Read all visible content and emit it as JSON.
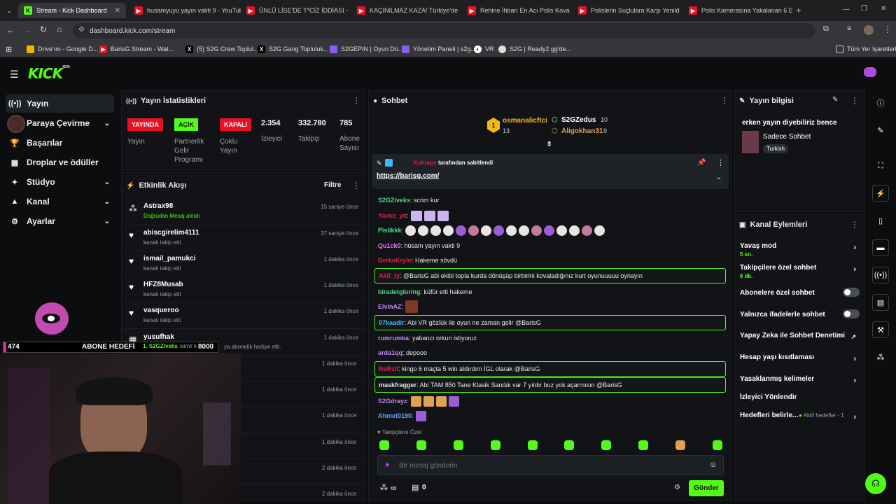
{
  "browser": {
    "tabs": [
      {
        "label": "Stream - Kick Dashboard",
        "active": true
      },
      {
        "label": "husamyuyu yayın vakti 9 - YouTube"
      },
      {
        "label": "ÜNLÜ LİSE'DE T*CİZ İDDİASI -"
      },
      {
        "label": "KAÇINILMAZ KAZA! Türkiye'de"
      },
      {
        "label": "Rehine İhbarı En Acı Polis Kova"
      },
      {
        "label": "Polislerin Suçlulara Karşı Yenild"
      },
      {
        "label": "Polis Kamerasına Yakalanan 6 E"
      }
    ],
    "url": "dashboard.kick.com/stream",
    "bookmarks": [
      "Drive'ım - Google D...",
      "BarisG Stream - Wat...",
      "(5) S2G Crew Toplul...",
      "S2G Gang Topluluk...",
      "S2GEPIN | Oyun Dü...",
      "Yönetim Paneli | s2g...",
      "VR",
      "S2G | Ready2.gg'de..."
    ],
    "all_bookmarks": "Tüm Yer İşaretleri"
  },
  "nav": {
    "items": [
      {
        "label": "Yayın",
        "icon": "broadcast-icon"
      },
      {
        "label": "Paraya Çevirme",
        "icon": "avatar"
      },
      {
        "label": "Başarılar",
        "icon": "trophy-icon"
      },
      {
        "label": "Droplar ve ödüller",
        "icon": "gift-icon"
      },
      {
        "label": "Stüdyo",
        "icon": "studio-icon"
      },
      {
        "label": "Kanal",
        "icon": "channel-icon"
      },
      {
        "label": "Ayarlar",
        "icon": "gear-icon"
      }
    ]
  },
  "stats": {
    "title": "Yayın İstatistikleri",
    "badges": [
      {
        "text": "YAYINDA",
        "label": "Yayın",
        "color": "#e81123"
      },
      {
        "text": "AÇIK",
        "label": "Partnerlik Gelir Programı",
        "color": "#53fc18"
      },
      {
        "text": "KAPALI",
        "label": "Çoklu Yayın",
        "color": "#e81123"
      }
    ],
    "numbers": [
      {
        "value": "2.354",
        "label": "İzleyici"
      },
      {
        "value": "332.780",
        "label": "Takipçi"
      },
      {
        "value": "785",
        "label": "Abone Sayısı"
      }
    ]
  },
  "activity": {
    "title": "Etkinlik Akışı",
    "filter": "Filtre",
    "events": [
      {
        "name": "Astrax98",
        "sub": "Doğrudan Mesaj alındı",
        "time": "15 saniye önce",
        "icon": "people-icon"
      },
      {
        "name": "abiscgirelim4111",
        "sub": "kanalı takip etti",
        "time": "37 saniye önce",
        "icon": "heart-icon"
      },
      {
        "name": "ismail_pamukci",
        "sub": "kanalı takip etti",
        "time": "1 dakika önce",
        "icon": "heart-icon"
      },
      {
        "name": "HFZ8Musab",
        "sub": "kanalı takip etti",
        "time": "1 dakika önce",
        "icon": "heart-icon"
      },
      {
        "name": "vasqueroo",
        "sub": "kanalı takip etti",
        "time": "1 dakika önce",
        "icon": "heart-icon"
      },
      {
        "name": "yusufhak",
        "sub": "ya abonelik hediye etti.",
        "time": "1 dakika önce",
        "icon": "gift-icon"
      }
    ],
    "extra_times": [
      "1 dakika önce",
      "1 dakika önce",
      "1 dakika önce",
      "1 dakika önce",
      "2 dakika önce",
      "2 dakika önce"
    ]
  },
  "overlay": {
    "count": "474",
    "goal_label": "ABONE HEDEFİ",
    "goal_target": "8000",
    "top_entry": "1. S2GZiveks",
    "top_suffix": "isimli k"
  },
  "chat": {
    "title": "Sohbet",
    "leaders": [
      {
        "rank": "1",
        "name": "osmanalicftci",
        "count": "13"
      },
      {
        "name": "S2GZedus",
        "count": "10"
      },
      {
        "name": "Aligokhan31",
        "count": "9"
      }
    ],
    "pinned": {
      "by": "Kohraps",
      "text": "tarafından sabitlendi",
      "link": "https://barisg.com/"
    },
    "messages": [
      {
        "user": "S2GZiveks",
        "color": "#4ade80",
        "text": ": scrim kur"
      },
      {
        "user": "Yavuz_yd",
        "color": "#e11d48",
        "text": ":"
      },
      {
        "user": "Pislikkk",
        "color": "#4ade80",
        "text": ":"
      },
      {
        "user": "Qu1ck0",
        "color": "#e879f9",
        "text": ": hüsam yayın vakti 9"
      },
      {
        "user": "BerkeKryln",
        "color": "#e11d48",
        "text": ": Hakeme sövdü"
      },
      {
        "user": "Akif_ty",
        "color": "#e11d48",
        "text": ": @BarisG abi ekibi topla kurda dönüşüp birbirini kovaladığınız kurt oyunuuuuu oynayın",
        "hl": true
      },
      {
        "user": "biradetgloring",
        "color": "#4ade80",
        "text": ": küfür etti hakeme"
      },
      {
        "user": "ElvinAZ",
        "color": "#c084fc",
        "text": ":"
      },
      {
        "user": "07kaadir",
        "color": "#38bdf8",
        "text": ": Abi VR gözlük ile oyun ne zaman gelir @BarisG",
        "hl": true
      },
      {
        "user": "rumrumka",
        "color": "#c084fc",
        "text": ": yabancı orkun istiyoruz"
      },
      {
        "user": "arda1qq",
        "color": "#c084fc",
        "text": ": depooo"
      },
      {
        "user": "ReRsll",
        "color": "#e11d48",
        "text": ": kingo 6 maçta 5 win aldırdım İGL olarak @BarisG",
        "hl": true
      },
      {
        "user": "maskfragger",
        "color": "#e8e8e8",
        "text": ": Abi TAM 850 Tane Klasik Sandık var 7 yıldır buz yok açarmısın @BarisG",
        "hl": true
      },
      {
        "user": "S2Gdrayz",
        "color": "#c084fc",
        "text": ":"
      },
      {
        "user": "Ahmet0190",
        "color": "#60a5fa",
        "text": ":"
      }
    ],
    "followers_only": "Takipçilere Özel",
    "input_placeholder": "Bir mesaj gönderin",
    "infinity": "∞",
    "counter": "0",
    "send": "Gönder"
  },
  "info": {
    "title": "Yayın bilgisi",
    "stream_title": "erken yayın diyebiliriz bence",
    "category": "Sadece Sohbet",
    "language": "Turkish"
  },
  "actions": {
    "title": "Kanal Eylemleri",
    "items": [
      {
        "label": "Yavaş mod",
        "sub": "5 sn.",
        "type": "arrow"
      },
      {
        "label": "Takipçilere özel sohbet",
        "sub": "6 dk.",
        "type": "arrow"
      },
      {
        "label": "Abonelere özel sohbet",
        "type": "toggle"
      },
      {
        "label": "Yalnızca ifadelerle sohbet",
        "type": "toggle"
      },
      {
        "label": "Yapay Zeka ile Sohbet Denetimi",
        "type": "external"
      },
      {
        "label": "Hesap yaşı kısıtlaması",
        "type": "arrow"
      },
      {
        "label": "Yasaklanmış kelimeler",
        "type": "arrow"
      },
      {
        "label": "İzleyici Yönlendir",
        "type": "none"
      },
      {
        "label": "Hedefleri belirle...",
        "sub": "Aktif hedefler - 1",
        "type": "arrow"
      }
    ]
  },
  "colors": {
    "accent": "#53fc18",
    "live": "#e81123",
    "panel": "#111316"
  }
}
